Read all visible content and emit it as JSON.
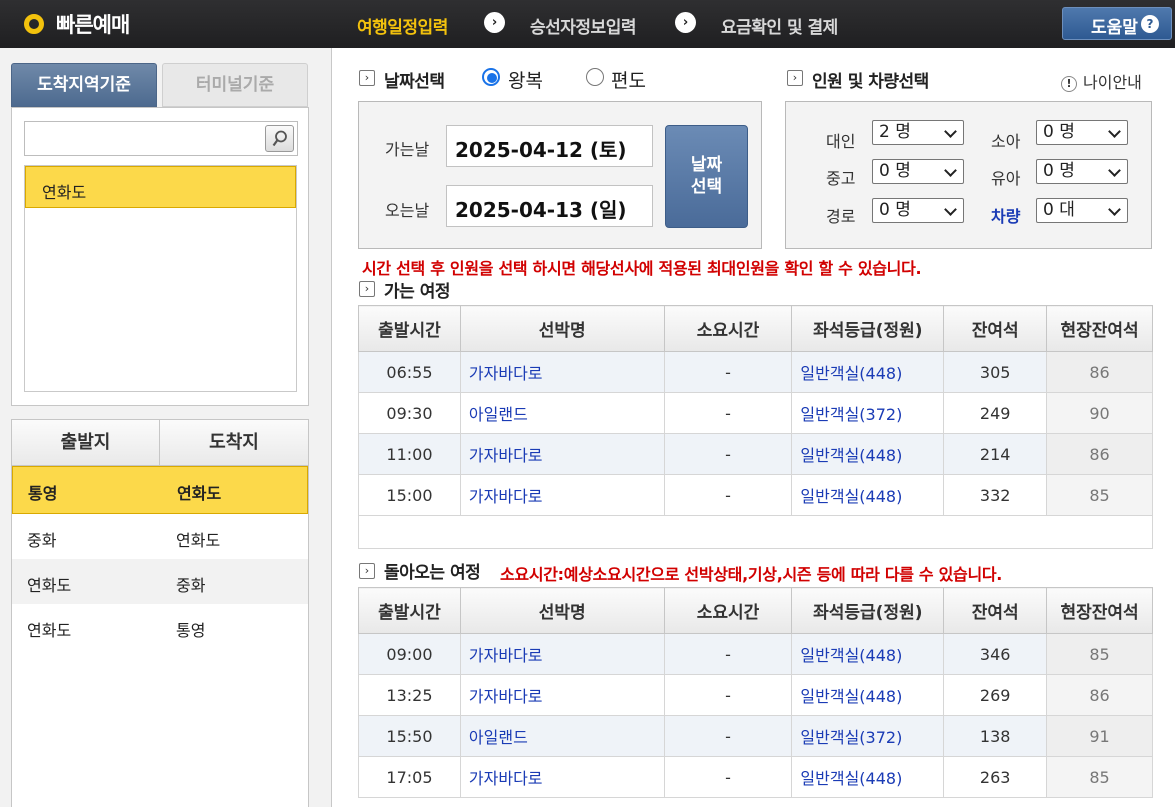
{
  "header": {
    "logo_text": "빠른예매",
    "steps": [
      "여행일정입력",
      "승선자정보입력",
      "요금확인 및 결제"
    ],
    "help_label": "도움말",
    "help_icon": "?"
  },
  "left": {
    "tabs": [
      "도착지역기준",
      "터미널기준"
    ],
    "search": {
      "value": "",
      "placeholder": ""
    },
    "destinations": [
      "연화도"
    ],
    "route_headers": [
      "출발지",
      "도착지"
    ],
    "routes": [
      {
        "from": "통영",
        "to": "연화도"
      },
      {
        "from": "중화",
        "to": "연화도"
      },
      {
        "from": "연화도",
        "to": "중화"
      },
      {
        "from": "연화도",
        "to": "통영"
      }
    ]
  },
  "date": {
    "title": "날짜선택",
    "trip_options": [
      "왕복",
      "편도"
    ],
    "selected_option": "왕복",
    "go_label": "가는날",
    "go_value": "2025-04-12 (토)",
    "return_label": "오는날",
    "return_value": "2025-04-13 (일)",
    "button_label_1": "날짜",
    "button_label_2": "선택"
  },
  "pax": {
    "title": "인원 및 차량선택",
    "age_info": "나이안내",
    "adult": {
      "label": "대인",
      "value": "2 명"
    },
    "child": {
      "label": "소아",
      "value": "0 명"
    },
    "student": {
      "label": "중고",
      "value": "0 명"
    },
    "infant": {
      "label": "유아",
      "value": "0 명"
    },
    "senior": {
      "label": "경로",
      "value": "0 명"
    },
    "vehicle": {
      "label": "차량",
      "value": "0 대"
    }
  },
  "notice_top": "시간 선택 후 인원을 선택 하시면 해당선사에 적용된 최대인원을 확인 할 수 있습니다.",
  "outbound": {
    "title": "가는 여정",
    "headers": [
      "출발시간",
      "선박명",
      "소요시간",
      "좌석등급(정원)",
      "잔여석",
      "현장잔여석"
    ],
    "rows": [
      {
        "time": "06:55",
        "ship": "가자바다로",
        "duration": "-",
        "seat": "일반객실(448)",
        "remain": "305",
        "onsite": "86"
      },
      {
        "time": "09:30",
        "ship": "아일랜드",
        "duration": "-",
        "seat": "일반객실(372)",
        "remain": "249",
        "onsite": "90"
      },
      {
        "time": "11:00",
        "ship": "가자바다로",
        "duration": "-",
        "seat": "일반객실(448)",
        "remain": "214",
        "onsite": "86"
      },
      {
        "time": "15:00",
        "ship": "가자바다로",
        "duration": "-",
        "seat": "일반객실(448)",
        "remain": "332",
        "onsite": "85"
      }
    ]
  },
  "inbound": {
    "title": "돌아오는 여정",
    "notice": "소요시간:예상소요시간으로 선박상태,기상,시즌 등에 따라 다를 수 있습니다.",
    "headers": [
      "출발시간",
      "선박명",
      "소요시간",
      "좌석등급(정원)",
      "잔여석",
      "현장잔여석"
    ],
    "rows": [
      {
        "time": "09:00",
        "ship": "가자바다로",
        "duration": "-",
        "seat": "일반객실(448)",
        "remain": "346",
        "onsite": "85"
      },
      {
        "time": "13:25",
        "ship": "가자바다로",
        "duration": "-",
        "seat": "일반객실(448)",
        "remain": "269",
        "onsite": "86"
      },
      {
        "time": "15:50",
        "ship": "아일랜드",
        "duration": "-",
        "seat": "일반객실(372)",
        "remain": "138",
        "onsite": "91"
      },
      {
        "time": "17:05",
        "ship": "가자바다로",
        "duration": "-",
        "seat": "일반객실(448)",
        "remain": "263",
        "onsite": "85"
      }
    ]
  }
}
